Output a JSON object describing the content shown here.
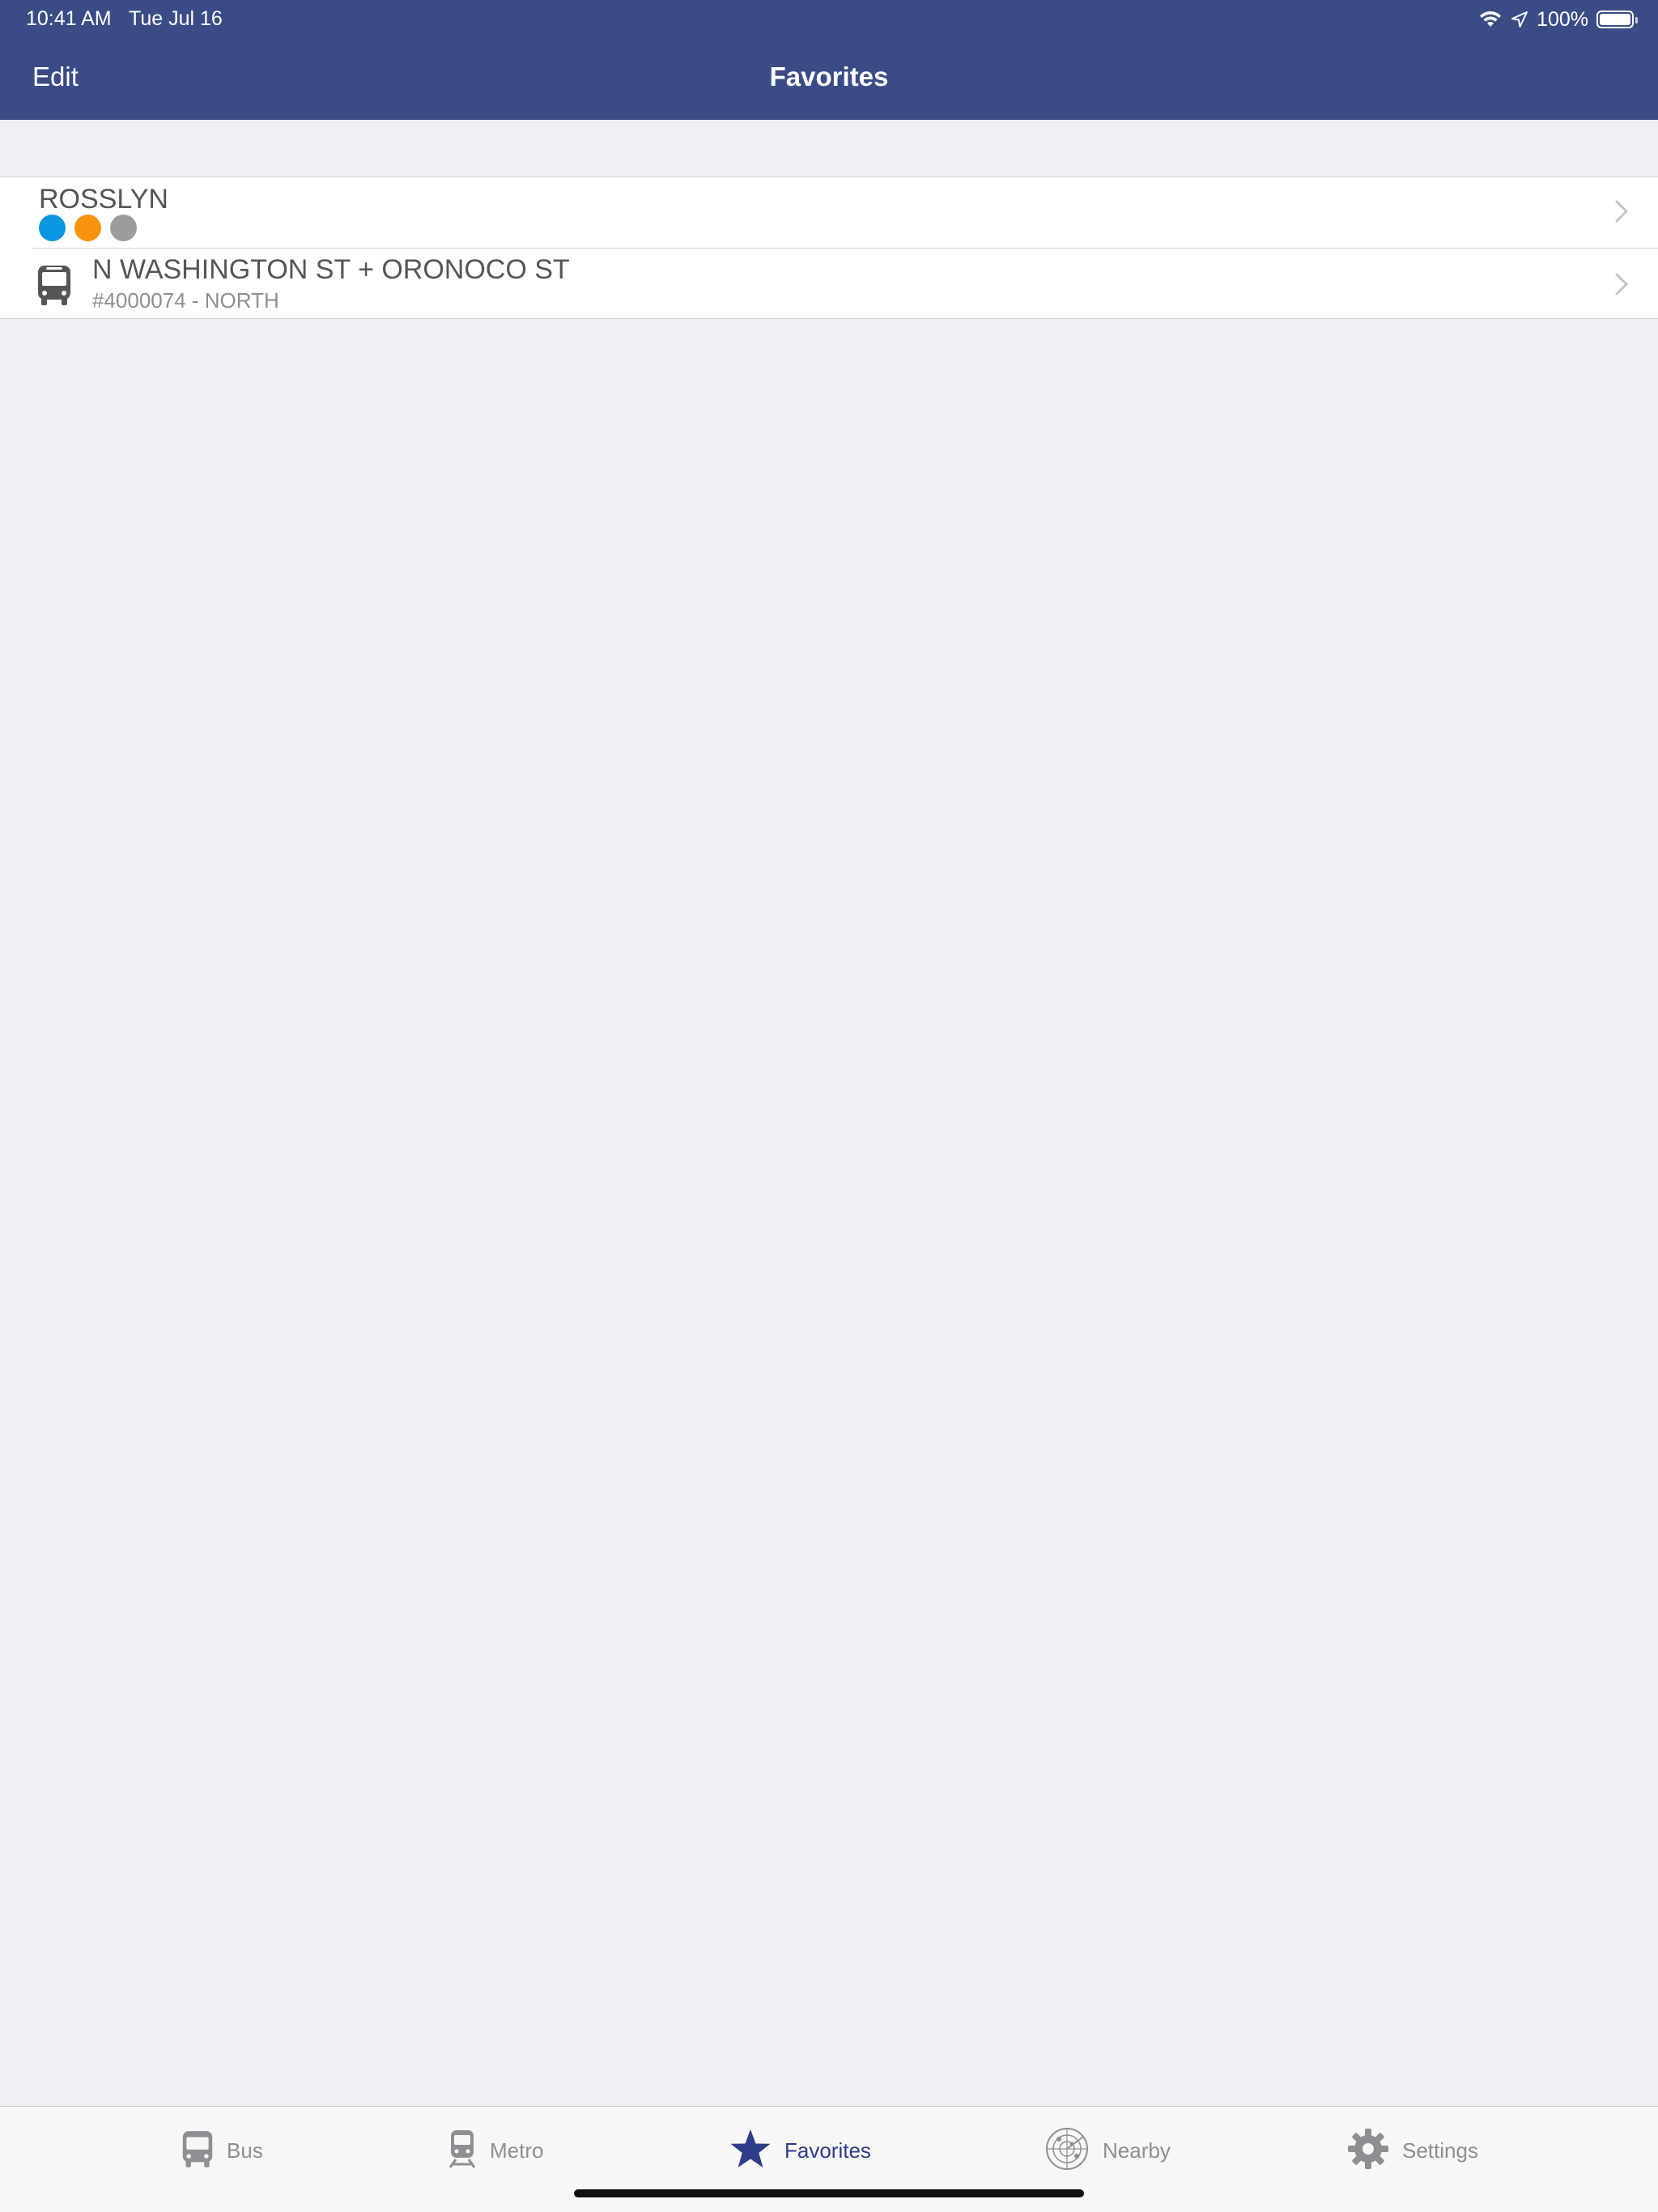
{
  "status_bar": {
    "time": "10:41 AM",
    "date": "Tue Jul 16",
    "battery": "100%"
  },
  "nav": {
    "edit_label": "Edit",
    "title": "Favorites"
  },
  "favorites": [
    {
      "title": "ROSSLYN",
      "type": "metro-station",
      "lines": [
        {
          "color": "#0a96e0"
        },
        {
          "color": "#f7930e"
        },
        {
          "color": "#9c9c9c"
        }
      ]
    },
    {
      "title": "N WASHINGTON ST + ORONOCO ST",
      "subtitle": "#4000074 - NORTH",
      "type": "bus-stop",
      "icon": "bus-icon"
    }
  ],
  "tabs": [
    {
      "label": "Bus",
      "icon": "bus-icon"
    },
    {
      "label": "Metro",
      "icon": "train-icon"
    },
    {
      "label": "Favorites",
      "icon": "star-icon",
      "active": true
    },
    {
      "label": "Nearby",
      "icon": "radar-icon"
    },
    {
      "label": "Settings",
      "icon": "gear-icon"
    }
  ],
  "colors": {
    "header": "#3b4b86",
    "background": "#efeff4",
    "active_tab": "#2e3c8a",
    "inactive_tab": "#8e8e93"
  }
}
